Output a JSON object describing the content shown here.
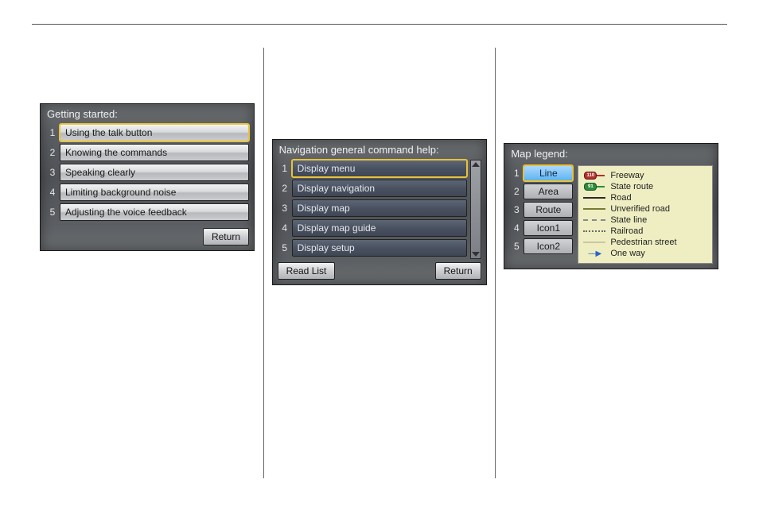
{
  "panel_a": {
    "title": "Getting started:",
    "items": [
      {
        "n": "1",
        "label": "Using the talk button",
        "selected": true
      },
      {
        "n": "2",
        "label": "Knowing the commands",
        "selected": false
      },
      {
        "n": "3",
        "label": "Speaking clearly",
        "selected": false
      },
      {
        "n": "4",
        "label": "Limiting background noise",
        "selected": false
      },
      {
        "n": "5",
        "label": "Adjusting the voice feedback",
        "selected": false
      }
    ],
    "return_label": "Return"
  },
  "panel_b": {
    "title": "Navigation general command help:",
    "items": [
      {
        "n": "1",
        "label": "Display menu",
        "selected": true
      },
      {
        "n": "2",
        "label": "Display navigation",
        "selected": false
      },
      {
        "n": "3",
        "label": "Display map",
        "selected": false
      },
      {
        "n": "4",
        "label": "Display map guide",
        "selected": false
      },
      {
        "n": "5",
        "label": "Display setup",
        "selected": false
      }
    ],
    "readlist_label": "Read List",
    "return_label": "Return"
  },
  "panel_c": {
    "title": "Map legend:",
    "categories": [
      {
        "n": "1",
        "label": "Line",
        "selected": true
      },
      {
        "n": "2",
        "label": "Area",
        "selected": false
      },
      {
        "n": "3",
        "label": "Route",
        "selected": false
      },
      {
        "n": "4",
        "label": "Icon1",
        "selected": false
      },
      {
        "n": "5",
        "label": "Icon2",
        "selected": false
      }
    ],
    "legend": [
      {
        "kind": "shield-red",
        "badge": "110",
        "label": "Freeway"
      },
      {
        "kind": "shield-grn",
        "badge": "91",
        "label": "State route"
      },
      {
        "kind": "line",
        "color": "#2b2b2b",
        "label": "Road"
      },
      {
        "kind": "line",
        "color": "#7a7a35",
        "label": "Unverified road"
      },
      {
        "kind": "dash",
        "color": "#8a8a8a",
        "label": "State line"
      },
      {
        "kind": "dot",
        "color": "#6a6a6a",
        "label": "Railroad"
      },
      {
        "kind": "line",
        "color": "#c9c9a0",
        "label": "Pedestrian street"
      },
      {
        "kind": "arrow",
        "color": "#2a63c8",
        "label": "One way"
      }
    ]
  }
}
